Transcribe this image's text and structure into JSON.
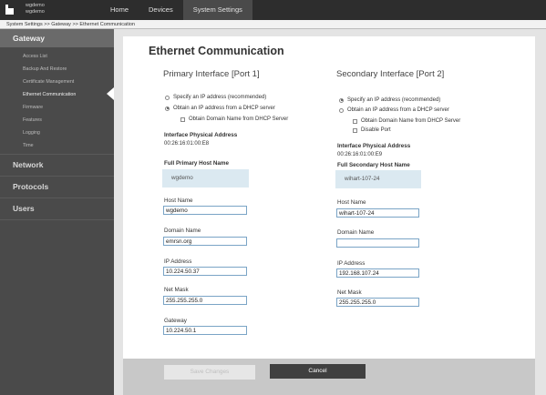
{
  "header": {
    "brand_line1": "wgdemo",
    "brand_line2": "wgdemo",
    "nav": [
      "Home",
      "Devices",
      "System Settings"
    ]
  },
  "breadcrumb": "System Settings >> Gateway >> Ethernet Communication",
  "sidebar": {
    "gateway": "Gateway",
    "items": [
      "Access List",
      "Backup And Restore",
      "Certificate Management",
      "Ethernet Communication",
      "Firmware",
      "Features",
      "Logging",
      "Time"
    ],
    "sections": [
      "Network",
      "Protocols",
      "Users"
    ]
  },
  "page": {
    "title": "Ethernet Communication",
    "primary": {
      "title": "Primary Interface [Port 1]",
      "radio_specify": "Specify an IP address (recommended)",
      "radio_dhcp": "Obtain an IP address from a DHCP server",
      "check_domain": "Obtain Domain Name from DHCP Server",
      "phys_label": "Interface Physical Address",
      "phys_value": "00:26:16:01:00:E8",
      "full_host_label": "Full Primary Host Name",
      "full_host_value": "wgdemo",
      "host_label": "Host Name",
      "host_value": "wgdemo",
      "domain_label": "Domain Name",
      "domain_value": "emrsn.org",
      "ip_label": "IP Address",
      "ip_value": "10.224.50.37",
      "mask_label": "Net Mask",
      "mask_value": "255.255.255.0",
      "gateway_label": "Gateway",
      "gateway_value": "10.224.50.1"
    },
    "secondary": {
      "title": "Secondary Interface [Port 2]",
      "radio_specify": "Specify an IP address (recommended)",
      "radio_dhcp": "Obtain an IP address from a DHCP server",
      "check_domain": "Obtain Domain Name from DHCP Server",
      "check_disable": "Disable Port",
      "phys_label": "Interface Physical Address",
      "phys_value": "00:26:16:01:00:E9",
      "full_host_label": "Full Secondary Host Name",
      "full_host_value": "wihart-107-24",
      "host_label": "Host Name",
      "host_value": "wihart-107-24",
      "domain_label": "Domain Name",
      "domain_value": "",
      "ip_label": "IP Address",
      "ip_value": "192.168.107.24",
      "mask_label": "Net Mask",
      "mask_value": "255.255.255.0"
    }
  },
  "footer": {
    "save": "Save Changes",
    "cancel": "Cancel"
  }
}
